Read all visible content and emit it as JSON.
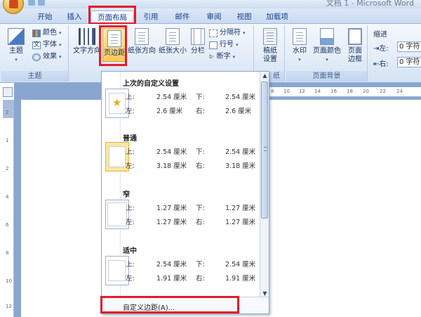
{
  "window": {
    "title": "文档 1 - Microsoft Word"
  },
  "tabs": [
    {
      "label": "开始",
      "active": false
    },
    {
      "label": "插入",
      "active": false
    },
    {
      "label": "页面布局",
      "active": true
    },
    {
      "label": "引用",
      "active": false
    },
    {
      "label": "邮件",
      "active": false
    },
    {
      "label": "审阅",
      "active": false
    },
    {
      "label": "视图",
      "active": false
    },
    {
      "label": "加载项",
      "active": false
    }
  ],
  "ribbon": {
    "theme_group": {
      "label": "主题",
      "theme_button": "主题",
      "colors": "颜色",
      "fonts": "字体",
      "effects": "效果"
    },
    "page_setup_group": {
      "text_direction": "文字方向",
      "margins": "页边距",
      "orientation": "纸张方向",
      "size": "纸张大小",
      "columns": "分栏",
      "breaks": "分隔符",
      "line_numbers": "行号",
      "hyphenation": "断字"
    },
    "manuscript_group": {
      "label_tail": "纸",
      "button": "稿纸\n设置"
    },
    "background_group": {
      "label": "页面背景",
      "watermark": "水印",
      "page_color": "页面颜色",
      "page_borders": "页面\n边框"
    },
    "indent_group": {
      "title": "缩进",
      "left_label": "左:",
      "right_label": "右:",
      "left_value": "0 字符",
      "right_value": "0 字符"
    }
  },
  "ruler": {
    "h_ticks": [
      "8",
      "10",
      "12",
      "14",
      "16",
      "18",
      "20",
      "22",
      "24"
    ],
    "v_ticks": [
      "2",
      "1",
      "2",
      "4",
      "6",
      "8",
      "10",
      "12"
    ]
  },
  "margins_menu": {
    "presets": [
      {
        "name": "上次的自定义设置",
        "top_label": "上:",
        "top": "2.54 厘米",
        "bottom_label": "下:",
        "bottom": "2.54 厘米",
        "left_label": "左:",
        "left": "2.6 厘米",
        "right_label": "右:",
        "right": "2.6 厘米",
        "icon": "star-icon",
        "selected": false
      },
      {
        "name": "普通",
        "top_label": "上:",
        "top": "2.54 厘米",
        "bottom_label": "下:",
        "bottom": "2.54 厘米",
        "left_label": "左:",
        "left": "3.18 厘米",
        "right_label": "右:",
        "right": "3.18 厘米",
        "icon": "page-icon",
        "selected": true
      },
      {
        "name": "窄",
        "top_label": "上:",
        "top": "1.27 厘米",
        "bottom_label": "下:",
        "bottom": "1.27 厘米",
        "left_label": "左:",
        "left": "1.27 厘米",
        "right_label": "右:",
        "right": "1.27 厘米",
        "icon": "page-icon",
        "selected": false
      },
      {
        "name": "适中",
        "top_label": "上:",
        "top": "2.54 厘米",
        "bottom_label": "下:",
        "bottom": "2.54 厘米",
        "left_label": "左:",
        "left": "1.91 厘米",
        "right_label": "右:",
        "right": "1.91 厘米",
        "icon": "page-icon",
        "selected": false
      }
    ],
    "custom_margins": "自定义边距(A)...",
    "scroll_up": "▲",
    "scroll_down": "▼"
  },
  "colors": {
    "highlight": "#e21d2a",
    "selected_thumb": "#fde7a2"
  }
}
